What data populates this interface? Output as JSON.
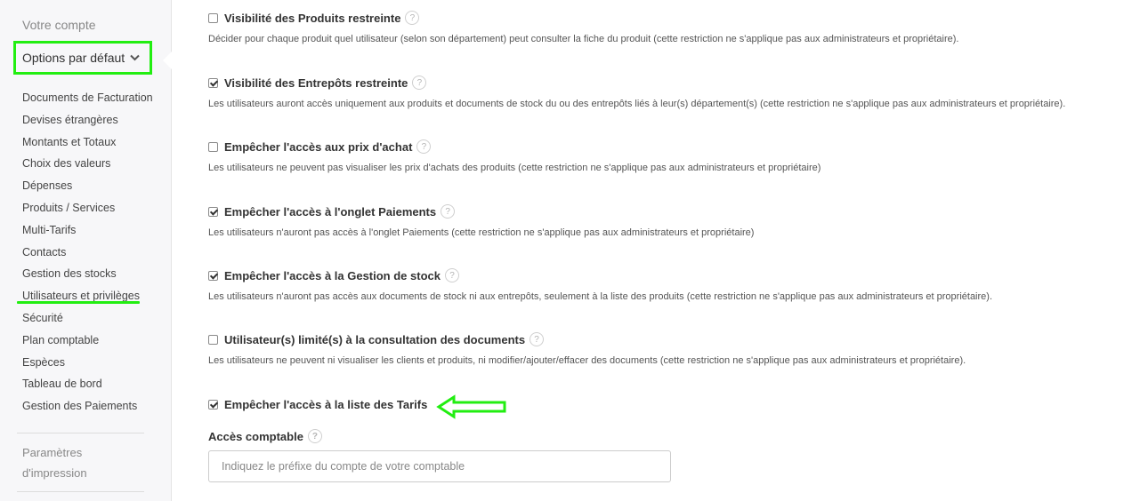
{
  "sidebar": {
    "account_label": "Votre compte",
    "options_label": "Options par défaut",
    "items": [
      {
        "label": "Documents de Facturation"
      },
      {
        "label": "Devises étrangères"
      },
      {
        "label": "Montants et Totaux"
      },
      {
        "label": "Choix des valeurs"
      },
      {
        "label": "Dépenses"
      },
      {
        "label": "Produits / Services"
      },
      {
        "label": "Multi-Tarifs"
      },
      {
        "label": "Contacts"
      },
      {
        "label": "Gestion des stocks"
      },
      {
        "label": "Utilisateurs et privilèges"
      },
      {
        "label": "Sécurité"
      },
      {
        "label": "Plan comptable"
      },
      {
        "label": "Espèces"
      },
      {
        "label": "Tableau de bord"
      },
      {
        "label": "Gestion des Paiements"
      }
    ],
    "print_settings_line1": "Paramètres",
    "print_settings_line2": "d'impression"
  },
  "options": [
    {
      "title": "Visibilité des Produits restreinte",
      "checked": false,
      "description": "Décider pour chaque produit quel utilisateur (selon son département) peut consulter la fiche du produit (cette restriction ne s'applique pas aux administrateurs et propriétaire)."
    },
    {
      "title": "Visibilité des Entrepôts restreinte",
      "checked": true,
      "description": "Les utilisateurs auront accès uniquement aux produits et documents de stock du ou des entrepôts liés à leur(s) département(s) (cette restriction ne s'applique pas aux administrateurs et propriétaire)."
    },
    {
      "title": "Empêcher l'accès aux prix d'achat",
      "checked": false,
      "description": "Les utilisateurs ne peuvent pas visualiser les prix d'achats des produits (cette restriction ne s'applique pas aux administrateurs et propriétaire)"
    },
    {
      "title": "Empêcher l'accès à l'onglet Paiements",
      "checked": true,
      "description": "Les utilisateurs n'auront pas accès à l'onglet Paiements (cette restriction ne s'applique pas aux administrateurs et propriétaire)"
    },
    {
      "title": "Empêcher l'accès à la Gestion de stock",
      "checked": true,
      "description": "Les utilisateurs n'auront pas accès aux documents de stock ni aux entrepôts, seulement à la liste des produits (cette restriction ne s'applique pas aux administrateurs et propriétaire)."
    },
    {
      "title": "Utilisateur(s) limité(s) à la consultation des documents",
      "checked": false,
      "description": "Les utilisateurs ne peuvent ni visualiser les clients et produits, ni modifier/ajouter/effacer des documents (cette restriction ne s'applique pas aux administrateurs et propriétaire)."
    },
    {
      "title": "Empêcher l'accès à la liste des Tarifs",
      "checked": true,
      "description": ""
    }
  ],
  "help_glyph": "?",
  "accounting": {
    "label": "Accès comptable",
    "placeholder": "Indiquez le préfixe du compte de votre comptable",
    "value": ""
  },
  "colors": {
    "highlight": "#22ee11",
    "sidebar_bg": "#f7f7f9"
  },
  "icons": {
    "options_chevron": "chevron-down-icon",
    "help": "help-circle-icon",
    "annotation": "arrow-left-icon"
  }
}
